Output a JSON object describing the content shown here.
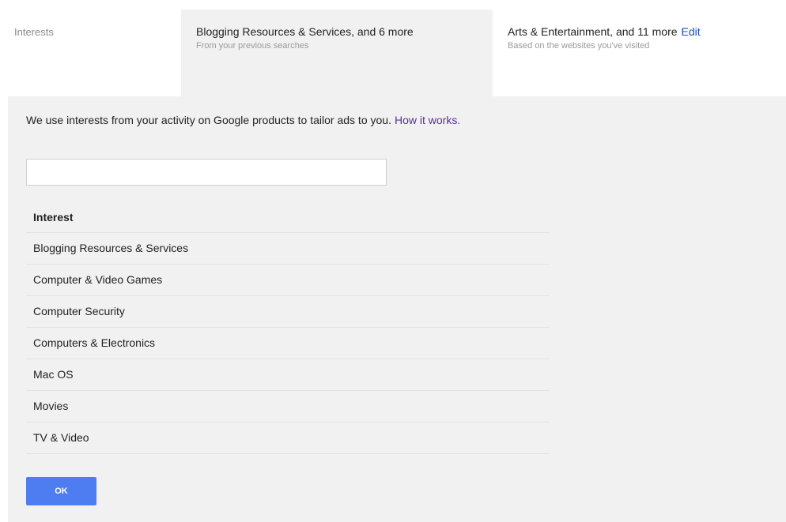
{
  "header": {
    "row_label": "Interests",
    "tabs": [
      {
        "title": "Blogging Resources & Services, and 6 more",
        "subtitle": "From your previous searches"
      },
      {
        "title": "Arts & Entertainment, and 11 more",
        "subtitle": "Based on the websites you've visited",
        "edit_label": "Edit"
      }
    ]
  },
  "panel": {
    "intro_text": "We use interests from your activity on Google products to tailor ads to you.",
    "how_it_works_label": "How it works.",
    "search": {
      "value": "",
      "placeholder": ""
    },
    "table": {
      "header": "Interest",
      "rows": [
        "Blogging Resources & Services",
        "Computer & Video Games",
        "Computer Security",
        "Computers & Electronics",
        "Mac OS",
        "Movies",
        "TV & Video"
      ]
    },
    "ok_label": "OK"
  },
  "colors": {
    "panel_background": "#f1f1f1",
    "link_blue": "#1a4fb5",
    "link_visited": "#5b2da3",
    "button_blue": "#4d7df0"
  }
}
